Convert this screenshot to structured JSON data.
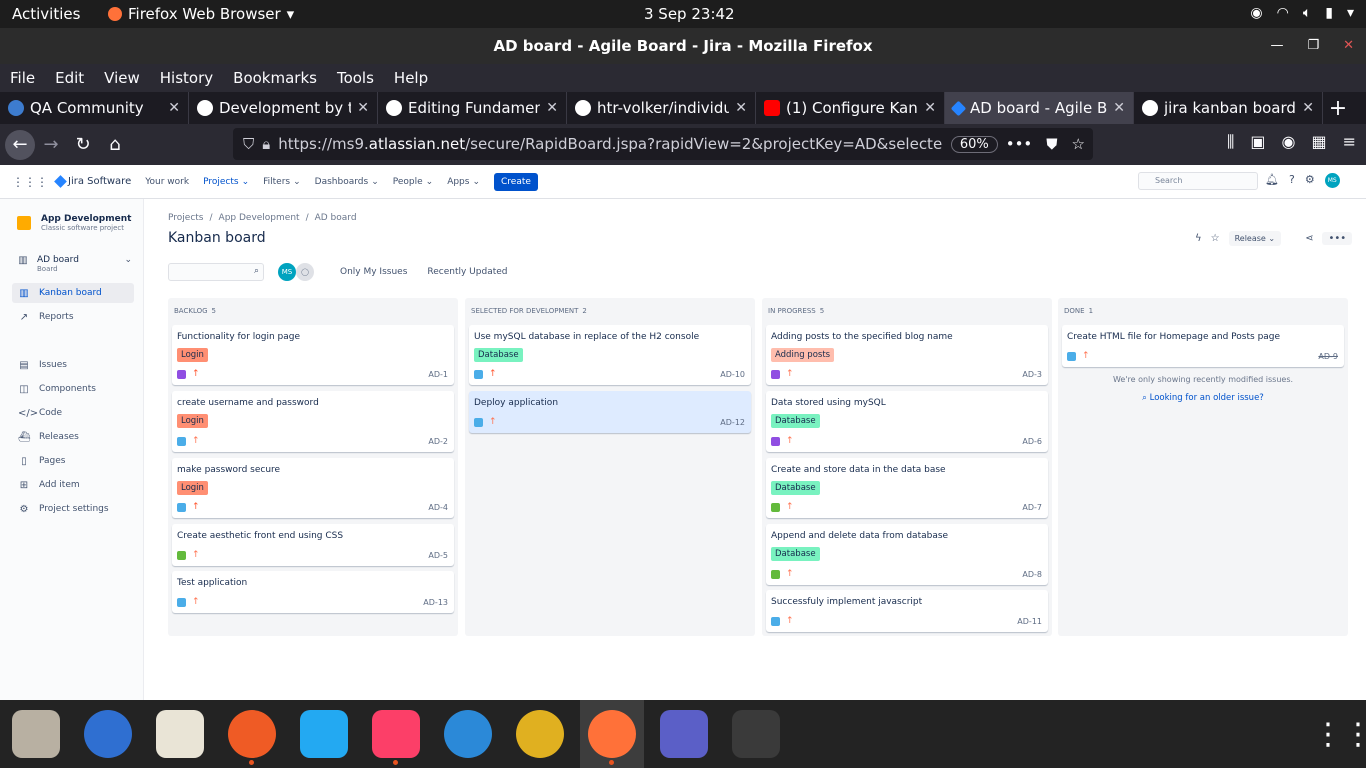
{
  "os": {
    "activities": "Activities",
    "app_menu": "Firefox Web Browser",
    "clock": "3 Sep  23:42"
  },
  "window": {
    "title": "AD board - Agile Board - Jira - Mozilla Firefox"
  },
  "menubar": [
    "File",
    "Edit",
    "View",
    "History",
    "Bookmarks",
    "Tools",
    "Help"
  ],
  "tabs": [
    {
      "label": "QA Community",
      "color": "#3d7ccf"
    },
    {
      "label": "Development by tv",
      "color": "#ffffff"
    },
    {
      "label": "Editing Fundament",
      "color": "#ffffff"
    },
    {
      "label": "htr-volker/individu",
      "color": "#ffffff"
    },
    {
      "label": "(1) Configure Kanb",
      "color": "#ff0000"
    },
    {
      "label": "AD board - Agile Bo",
      "color": "#2684ff"
    },
    {
      "label": "jira kanban board e",
      "color": "#ffffff"
    }
  ],
  "urlbar": {
    "prefix": "https://ms9.",
    "host": "atlassian.net",
    "path": "/secure/RapidBoard.jspa?rapidView=2&projectKey=AD&selectedIss",
    "zoom": "60%"
  },
  "jira_nav": {
    "product": "Jira Software",
    "your_work": "Your work",
    "projects": "Projects",
    "filters": "Filters",
    "dashboards": "Dashboards",
    "people": "People",
    "apps": "Apps",
    "create": "Create",
    "search_placeholder": "Search",
    "user_initials": "MS"
  },
  "sidebar": {
    "project_name": "App Development",
    "project_type": "Classic software project",
    "board_name": "AD board",
    "board_sub": "Board",
    "items": [
      {
        "label": "Kanban board",
        "icon": "columns-icon"
      },
      {
        "label": "Reports",
        "icon": "chart-icon"
      },
      {
        "label": "Issues",
        "icon": "issues-icon"
      },
      {
        "label": "Components",
        "icon": "components-icon"
      },
      {
        "label": "Code",
        "icon": "code-icon"
      },
      {
        "label": "Releases",
        "icon": "releases-icon"
      },
      {
        "label": "Pages",
        "icon": "pages-icon"
      },
      {
        "label": "Add item",
        "icon": "add-item-icon"
      },
      {
        "label": "Project settings",
        "icon": "gear-icon"
      }
    ]
  },
  "board": {
    "breadcrumb": [
      "Projects",
      "App Development",
      "AD board"
    ],
    "title": "Kanban board",
    "release_label": "Release",
    "quick_filters": [
      "Only My Issues",
      "Recently Updated"
    ],
    "columns": [
      {
        "name": "BACKLOG",
        "count": "5",
        "cards": [
          {
            "title": "Functionality for login page",
            "label": "Login",
            "type": "subtask",
            "key": "AD-1"
          },
          {
            "title": "create username and password",
            "label": "Login",
            "type": "task",
            "key": "AD-2"
          },
          {
            "title": "make password secure",
            "label": "Login",
            "type": "task",
            "key": "AD-4"
          },
          {
            "title": "Create aesthetic front end using CSS",
            "label": "",
            "type": "story",
            "key": "AD-5"
          },
          {
            "title": "Test application",
            "label": "",
            "type": "task",
            "key": "AD-13"
          }
        ]
      },
      {
        "name": "SELECTED FOR DEVELOPMENT",
        "count": "2",
        "cards": [
          {
            "title": "Use mySQL database in replace of the H2 console",
            "label": "Database",
            "type": "task",
            "key": "AD-10"
          },
          {
            "title": "Deploy application",
            "label": "",
            "type": "task",
            "key": "AD-12"
          }
        ]
      },
      {
        "name": "IN PROGRESS",
        "count": "5",
        "cards": [
          {
            "title": "Adding posts to the specified blog name",
            "label": "Adding posts",
            "type": "subtask",
            "key": "AD-3"
          },
          {
            "title": "Data stored using mySQL",
            "label": "Database",
            "type": "subtask",
            "key": "AD-6"
          },
          {
            "title": "Create and store data in the data base",
            "label": "Database",
            "type": "story",
            "key": "AD-7"
          },
          {
            "title": "Append and delete data from database",
            "label": "Database",
            "type": "story",
            "key": "AD-8"
          },
          {
            "title": "Successfuly implement javascript",
            "label": "",
            "type": "task",
            "key": "AD-11"
          }
        ]
      },
      {
        "name": "DONE",
        "count": "1",
        "cards": [
          {
            "title": "Create HTML file for Homepage and Posts page",
            "label": "",
            "type": "task",
            "key": "AD-9"
          }
        ],
        "note": "We're only showing recently modified issues.",
        "link": "Looking for an older issue?"
      }
    ]
  },
  "dock": [
    {
      "name": "files-app",
      "color": "#b8b0a2"
    },
    {
      "name": "thunderbird-app",
      "color": "#2f6fd1"
    },
    {
      "name": "rhythmbox-app",
      "color": "#e9e4d6"
    },
    {
      "name": "postman-app",
      "color": "#ef5b25"
    },
    {
      "name": "vscode-app",
      "color": "#23a9f2"
    },
    {
      "name": "intellij-app",
      "color": "#fc3f68"
    },
    {
      "name": "help-app",
      "color": "#2b89d8"
    },
    {
      "name": "chrome-app",
      "color": "#e0b020"
    },
    {
      "name": "firefox-app",
      "color": "#ff7139"
    },
    {
      "name": "teams-app",
      "color": "#5b5fc7"
    },
    {
      "name": "terminal-app",
      "color": "#3a3a3a"
    }
  ]
}
